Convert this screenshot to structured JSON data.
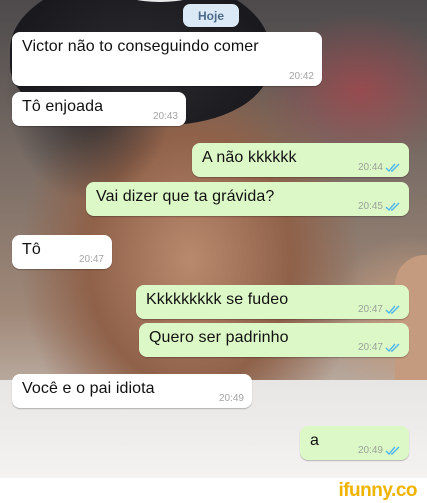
{
  "chat": {
    "day_label": "Hoje",
    "messages": [
      {
        "direction": "in",
        "text": "Victor não to conseguindo comer",
        "time": "20:42"
      },
      {
        "direction": "in",
        "text": "Tô enjoada",
        "time": "20:43"
      },
      {
        "direction": "out",
        "text": "A não kkkkkk",
        "time": "20:44",
        "status": "read"
      },
      {
        "direction": "out",
        "text": "Vai dizer que ta grávida?",
        "time": "20:45",
        "status": "read"
      },
      {
        "direction": "in",
        "text": "Tô",
        "time": "20:47"
      },
      {
        "direction": "out",
        "text": "Kkkkkkkkk se fudeo",
        "time": "20:47",
        "status": "read"
      },
      {
        "direction": "out",
        "text": "Quero ser padrinho",
        "time": "20:47",
        "status": "read"
      },
      {
        "direction": "in",
        "text": "Você e o pai idiota",
        "time": "20:49"
      },
      {
        "direction": "out",
        "text": "a",
        "time": "20:49",
        "status": "read"
      }
    ]
  },
  "watermark": {
    "text": "ifunny.co"
  },
  "colors": {
    "incoming_bubble": "#ffffff",
    "outgoing_bubble": "#dcf8c6",
    "read_ticks": "#4fb6ec",
    "day_chip": "#dbe9f6",
    "brand": "#f0b400"
  },
  "icons": {
    "read_receipt": "double-check-icon"
  }
}
